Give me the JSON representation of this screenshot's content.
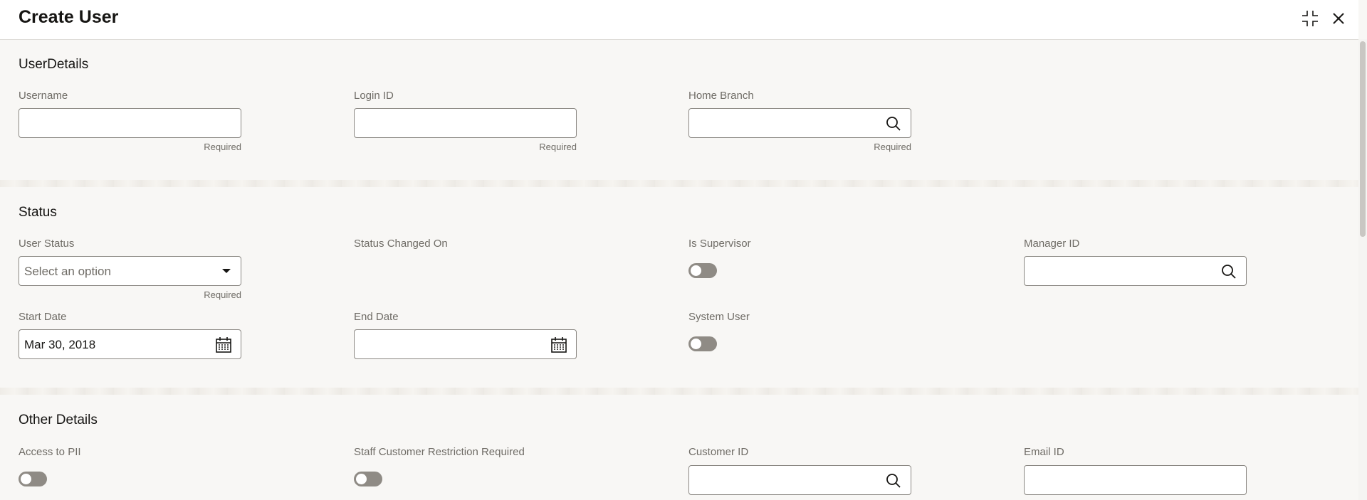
{
  "header": {
    "title": "Create User"
  },
  "user_details": {
    "title": "UserDetails",
    "username": {
      "label": "Username",
      "value": "",
      "required": "Required"
    },
    "login_id": {
      "label": "Login ID",
      "value": "",
      "required": "Required"
    },
    "home_branch": {
      "label": "Home Branch",
      "value": "",
      "required": "Required"
    }
  },
  "status": {
    "title": "Status",
    "user_status": {
      "label": "User Status",
      "placeholder": "Select an option",
      "required": "Required"
    },
    "status_changed_on": {
      "label": "Status Changed On"
    },
    "is_supervisor": {
      "label": "Is Supervisor",
      "on": false
    },
    "manager_id": {
      "label": "Manager ID",
      "value": ""
    },
    "start_date": {
      "label": "Start Date",
      "value": "Mar 30, 2018"
    },
    "end_date": {
      "label": "End Date",
      "value": ""
    },
    "system_user": {
      "label": "System User",
      "on": false
    }
  },
  "other_details": {
    "title": "Other Details",
    "access_to_pii": {
      "label": "Access to PII",
      "on": false
    },
    "staff_customer_restriction": {
      "label": "Staff Customer Restriction Required",
      "on": false
    },
    "customer_id": {
      "label": "Customer ID",
      "value": ""
    },
    "email_id": {
      "label": "Email ID",
      "value": ""
    }
  },
  "icons": {
    "expand": "collapse-icon",
    "close": "close-icon",
    "search": "search-icon",
    "dropdown": "chevron-down-icon",
    "calendar": "calendar-icon"
  }
}
